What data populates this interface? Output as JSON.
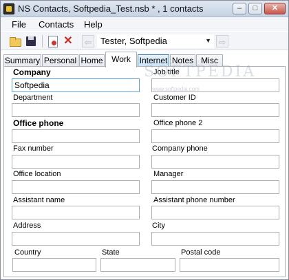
{
  "window": {
    "title": "NS Contacts, Softpedia_Test.nsb * , 1 contacts",
    "minimize_glyph": "–",
    "maximize_glyph": "□",
    "close_glyph": "✕"
  },
  "menu": {
    "items": [
      "File",
      "Contacts",
      "Help"
    ]
  },
  "toolbar": {
    "icons": [
      "folder-open-icon",
      "save-icon",
      "new-contact-icon",
      "delete-icon",
      "back-arrow-icon",
      "forward-arrow-icon"
    ],
    "delete_glyph": "✕",
    "back_glyph": "⇦",
    "forward_glyph": "⇨",
    "selected_contact": "Tester, Softpedia",
    "dropdown_glyph": "▼"
  },
  "tabs": [
    "Summary",
    "Personal",
    "Home",
    "Work",
    "Internet",
    "Notes",
    "Misc"
  ],
  "active_tab": "Work",
  "form": {
    "company_label": "Company",
    "company_value": "Softpedia",
    "job_title_label": "Job title",
    "job_title_value": "",
    "department_label": "Department",
    "department_value": "",
    "customer_id_label": "Customer ID",
    "customer_id_value": "",
    "office_phone_label": "Office phone",
    "office_phone_value": "",
    "office_phone_2_label": "Office phone 2",
    "office_phone_2_value": "",
    "fax_label": "Fax number",
    "fax_value": "",
    "company_phone_label": "Company phone",
    "company_phone_value": "",
    "office_location_label": "Office location",
    "office_location_value": "",
    "manager_label": "Manager",
    "manager_value": "",
    "assistant_name_label": "Assistant name",
    "assistant_name_value": "",
    "assistant_phone_label": "Assistant phone number",
    "assistant_phone_value": "",
    "address_label": "Address",
    "address_value": "",
    "city_label": "City",
    "city_value": "",
    "country_label": "Country",
    "country_value": "",
    "state_label": "State",
    "state_value": "",
    "postal_code_label": "Postal code",
    "postal_code_value": ""
  },
  "watermark": {
    "text": "SOFTPEDIA",
    "url": "www.softpedia.com"
  }
}
